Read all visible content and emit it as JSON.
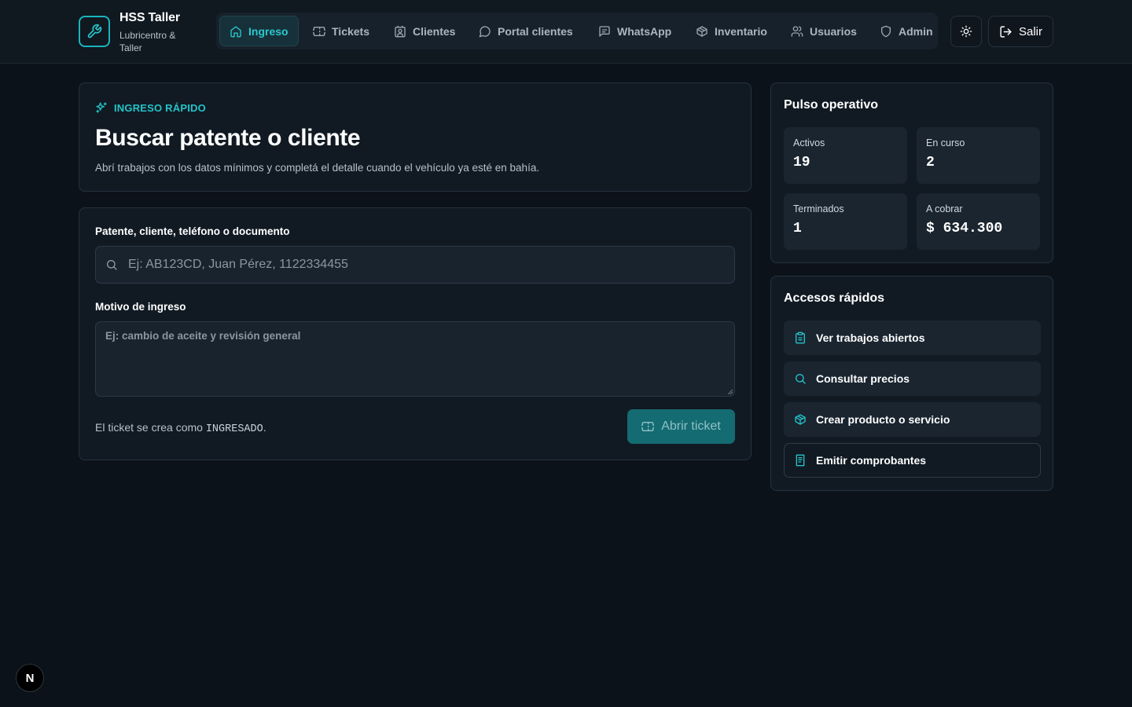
{
  "brand": {
    "name": "HSS Taller",
    "subtitle": "Lubricentro & Taller"
  },
  "nav": {
    "items": [
      {
        "label": "Ingreso",
        "icon": "home-icon",
        "active": true
      },
      {
        "label": "Tickets",
        "icon": "ticket-icon",
        "active": false
      },
      {
        "label": "Clientes",
        "icon": "contact-icon",
        "active": false
      },
      {
        "label": "Portal clientes",
        "icon": "chat-bubble-icon",
        "active": false
      },
      {
        "label": "WhatsApp",
        "icon": "message-square-icon",
        "active": false
      },
      {
        "label": "Inventario",
        "icon": "package-icon",
        "active": false
      },
      {
        "label": "Usuarios",
        "icon": "users-icon",
        "active": false
      },
      {
        "label": "Admin",
        "icon": "shield-icon",
        "active": false
      }
    ]
  },
  "header": {
    "logout_label": "Salir",
    "theme_icon": "sun-icon"
  },
  "hero": {
    "eyebrow": "INGRESO RÁPIDO",
    "title": "Buscar patente o cliente",
    "description": "Abrí trabajos con los datos mínimos y completá el detalle cuando el vehículo ya esté en bahía."
  },
  "form": {
    "search_label": "Patente, cliente, teléfono o documento",
    "search_placeholder": "Ej: AB123CD, Juan Pérez, 1122334455",
    "search_value": "",
    "reason_label": "Motivo de ingreso",
    "reason_placeholder": "Ej: cambio de aceite y revisión general",
    "reason_value": "",
    "note_prefix": "El ticket se crea como ",
    "note_status": "INGRESADO",
    "note_suffix": ".",
    "submit_label": "Abrir ticket"
  },
  "pulse": {
    "title": "Pulso operativo",
    "stats": [
      {
        "label": "Activos",
        "value": "19"
      },
      {
        "label": "En curso",
        "value": "2"
      },
      {
        "label": "Terminados",
        "value": "1"
      },
      {
        "label": "A cobrar",
        "value": "$ 634.300"
      }
    ]
  },
  "quick": {
    "title": "Accesos rápidos",
    "items": [
      {
        "label": "Ver trabajos abiertos",
        "icon": "clipboard-icon"
      },
      {
        "label": "Consultar precios",
        "icon": "search-icon"
      },
      {
        "label": "Crear producto o servicio",
        "icon": "package-icon"
      },
      {
        "label": "Emitir comprobantes",
        "icon": "receipt-icon"
      }
    ]
  },
  "dev_badge": "N",
  "colors": {
    "accent": "#25c3c8",
    "background": "#0c1219",
    "card": "#111a23",
    "button": "#146b72"
  }
}
